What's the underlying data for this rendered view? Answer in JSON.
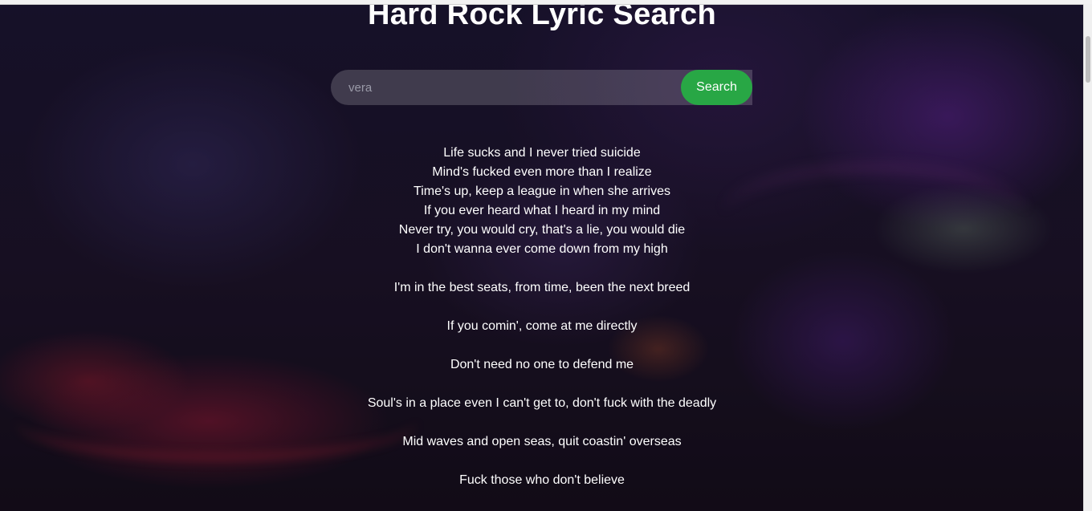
{
  "page": {
    "title": "Hard Rock Lyric Search"
  },
  "search": {
    "value": "vera",
    "button_label": "Search"
  },
  "lyrics": {
    "lines": [
      "Life sucks and I never tried suicide",
      "Mind's fucked even more than I realize",
      "Time's up, keep a league in when she arrives",
      "If you ever heard what I heard in my mind",
      "Never try, you would cry, that's a lie, you would die",
      "I don't wanna ever come down from my high",
      "",
      "I'm in the best seats, from time, been the next breed",
      "",
      "If you comin', come at me directly",
      "",
      "Don't need no one to defend me",
      "",
      "Soul's in a place even I can't get to, don't fuck with the deadly",
      "",
      "Mid waves and open seas, quit coastin' overseas",
      "",
      "Fuck those who don't believe"
    ]
  },
  "colors": {
    "button_bg": "#28a745",
    "text": "#ffffff",
    "background": "#140f1f"
  }
}
